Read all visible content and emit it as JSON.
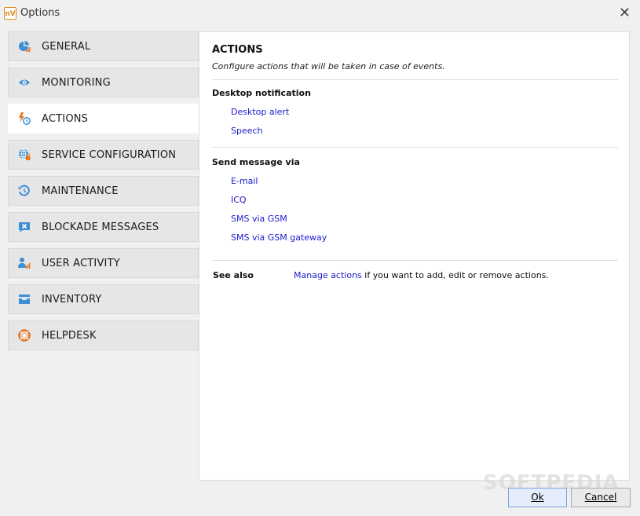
{
  "window": {
    "title": "Options",
    "app_icon_text": "nV"
  },
  "sidebar": {
    "items": [
      {
        "label": "GENERAL",
        "icon": "pie-chart-icon"
      },
      {
        "label": "MONITORING",
        "icon": "eye-icon"
      },
      {
        "label": "ACTIONS",
        "icon": "bolt-clock-icon",
        "active": true
      },
      {
        "label": "SERVICE CONFIGURATION",
        "icon": "globe-lock-icon"
      },
      {
        "label": "MAINTENANCE",
        "icon": "history-icon"
      },
      {
        "label": "BLOCKADE MESSAGES",
        "icon": "message-x-icon"
      },
      {
        "label": "USER ACTIVITY",
        "icon": "user-chart-icon"
      },
      {
        "label": "INVENTORY",
        "icon": "tray-icon"
      },
      {
        "label": "HELPDESK",
        "icon": "lifebuoy-icon"
      }
    ]
  },
  "panel": {
    "title": "ACTIONS",
    "description": "Configure actions that will be taken in case of events.",
    "desktop_section": {
      "heading": "Desktop notification",
      "links": [
        "Desktop alert",
        "Speech"
      ]
    },
    "message_section": {
      "heading": "Send message via",
      "links": [
        "E-mail",
        "ICQ",
        "SMS via GSM",
        "SMS via GSM gateway"
      ]
    },
    "see_also": {
      "label": "See also",
      "link": "Manage actions",
      "text": " if you want to add, edit or remove actions."
    }
  },
  "buttons": {
    "ok": "Ok",
    "cancel": "Cancel"
  },
  "watermark": "SOFTPEDIA",
  "colors": {
    "link": "#1a1acc",
    "accent_orange": "#e87722",
    "icon_blue": "#3d8fd6"
  }
}
